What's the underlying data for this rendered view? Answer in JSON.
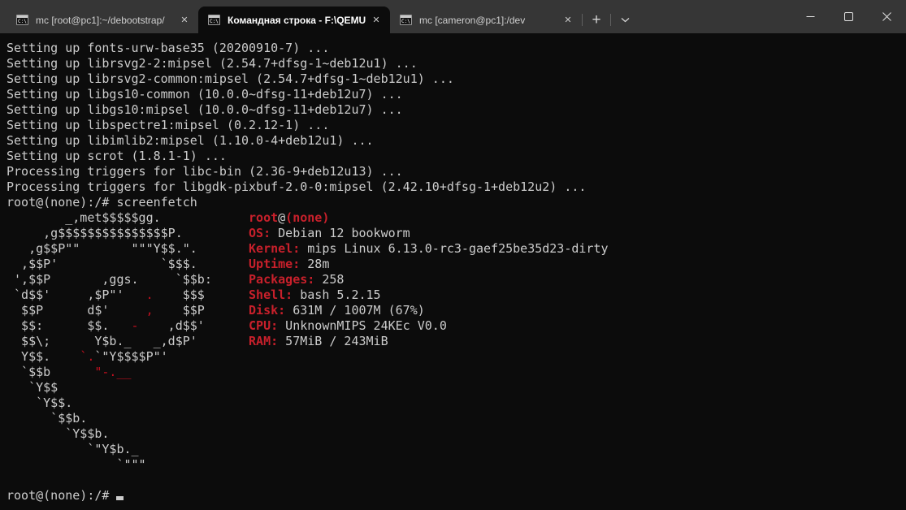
{
  "tabbar": {
    "close_glyph": "✕",
    "new_tab_glyph": "+",
    "tabs": [
      {
        "title": "mc [root@pc1]:~/debootstrap/",
        "active": false
      },
      {
        "title": "Командная строка - F:\\QEMU",
        "active": true
      },
      {
        "title": "mc [cameron@pc1]:/dev",
        "active": false
      }
    ],
    "icons": {
      "tab_icon": "cmd-window-icon",
      "tab_icon_text": "C:\\",
      "new_tab": "plus-icon",
      "dropdown": "chevron-down-icon",
      "minimize": "minimize-icon",
      "maximize": "maximize-icon",
      "close": "close-icon"
    }
  },
  "colors": {
    "terminal_bg": "#0c0c0c",
    "terminal_fg": "#cccccc",
    "accent_red": "#c50f1f",
    "tabbar_bg": "#363636",
    "active_tab_bg": "#0c0c0c"
  },
  "system_info": {
    "user_host": "root@(none)",
    "os": "Debian 12 bookworm",
    "kernel": "mips Linux 6.13.0-rc3-gaef25be35d23-dirty",
    "uptime": "28m",
    "packages": "258",
    "shell": "bash 5.2.15",
    "disk": "631M / 1007M (67%)",
    "cpu": "UnknownMIPS 24KEc V0.0",
    "ram": "57MiB / 243MiB"
  },
  "terminal": {
    "prompt": "root@(none):/# ",
    "lines": [
      "Setting up fonts-urw-base35 (20200910-7) ...",
      "Setting up librsvg2-2:mipsel (2.54.7+dfsg-1~deb12u1) ...",
      "Setting up librsvg2-common:mipsel (2.54.7+dfsg-1~deb12u1) ...",
      "Setting up libgs10-common (10.0.0~dfsg-11+deb12u7) ...",
      "Setting up libgs10:mipsel (10.0.0~dfsg-11+deb12u7) ...",
      "Setting up libspectre1:mipsel (0.2.12-1) ...",
      "Setting up libimlib2:mipsel (1.10.0-4+deb12u1) ...",
      "Setting up scrot (1.8.1-1) ...",
      "Processing triggers for libc-bin (2.36-9+deb12u13) ...",
      "Processing triggers for libgdk-pixbuf-2.0-0:mipsel (2.42.10+dfsg-1+deb12u2) ...",
      "root@(none):/# screenfetch",
      [
        {
          "t": "        _,met$$$$$gg.            "
        },
        {
          "t": "root",
          "c": "rb"
        },
        {
          "t": "@"
        },
        {
          "t": "(none)",
          "c": "rb"
        }
      ],
      [
        {
          "t": "     ,g$$$$$$$$$$$$$$$P.         "
        },
        {
          "t": "OS:",
          "c": "rb"
        },
        {
          "t": " Debian 12 bookworm"
        }
      ],
      [
        {
          "t": "   ,g$$P\"\"       \"\"\"Y$$.\".       "
        },
        {
          "t": "Kernel:",
          "c": "rb"
        },
        {
          "t": " mips Linux 6.13.0-rc3-gaef25be35d23-dirty"
        }
      ],
      [
        {
          "t": "  ,$$P'              `$$$.       "
        },
        {
          "t": "Uptime:",
          "c": "rb"
        },
        {
          "t": " 28m"
        }
      ],
      [
        {
          "t": " ',$$P       ,ggs.     `$$b:     "
        },
        {
          "t": "Packages:",
          "c": "rb"
        },
        {
          "t": " 258"
        }
      ],
      [
        {
          "t": " `d$$'     ,$P\"'   "
        },
        {
          "t": ".",
          "c": "r"
        },
        {
          "t": "    $$$      "
        },
        {
          "t": "Shell:",
          "c": "rb"
        },
        {
          "t": " bash 5.2.15"
        }
      ],
      [
        {
          "t": "  $$P      d$'     "
        },
        {
          "t": ",",
          "c": "r"
        },
        {
          "t": "    $$P      "
        },
        {
          "t": "Disk:",
          "c": "rb"
        },
        {
          "t": " 631M / 1007M (67%)"
        }
      ],
      [
        {
          "t": "  $$:      $$.   "
        },
        {
          "t": "-",
          "c": "r"
        },
        {
          "t": "    ,d$$'      "
        },
        {
          "t": "CPU:",
          "c": "rb"
        },
        {
          "t": " UnknownMIPS 24KEc V0.0"
        }
      ],
      [
        {
          "t": "  $$\\;      Y$b._   _,d$P'       "
        },
        {
          "t": "RAM:",
          "c": "rb"
        },
        {
          "t": " 57MiB / 243MiB"
        }
      ],
      [
        {
          "t": "  Y$$.    "
        },
        {
          "t": "`.",
          "c": "r"
        },
        {
          "t": "`\"Y$$$$P\"'"
        }
      ],
      [
        {
          "t": "  `$$b      "
        },
        {
          "t": "\"-.__",
          "c": "r"
        }
      ],
      "   `Y$$",
      "    `Y$$.",
      "      `$$b.",
      "        `Y$$b.",
      "           `\"Y$b._",
      "               `\"\"\"",
      "",
      [
        {
          "t": "root@(none):/# "
        },
        {
          "cursor": true
        }
      ]
    ]
  }
}
